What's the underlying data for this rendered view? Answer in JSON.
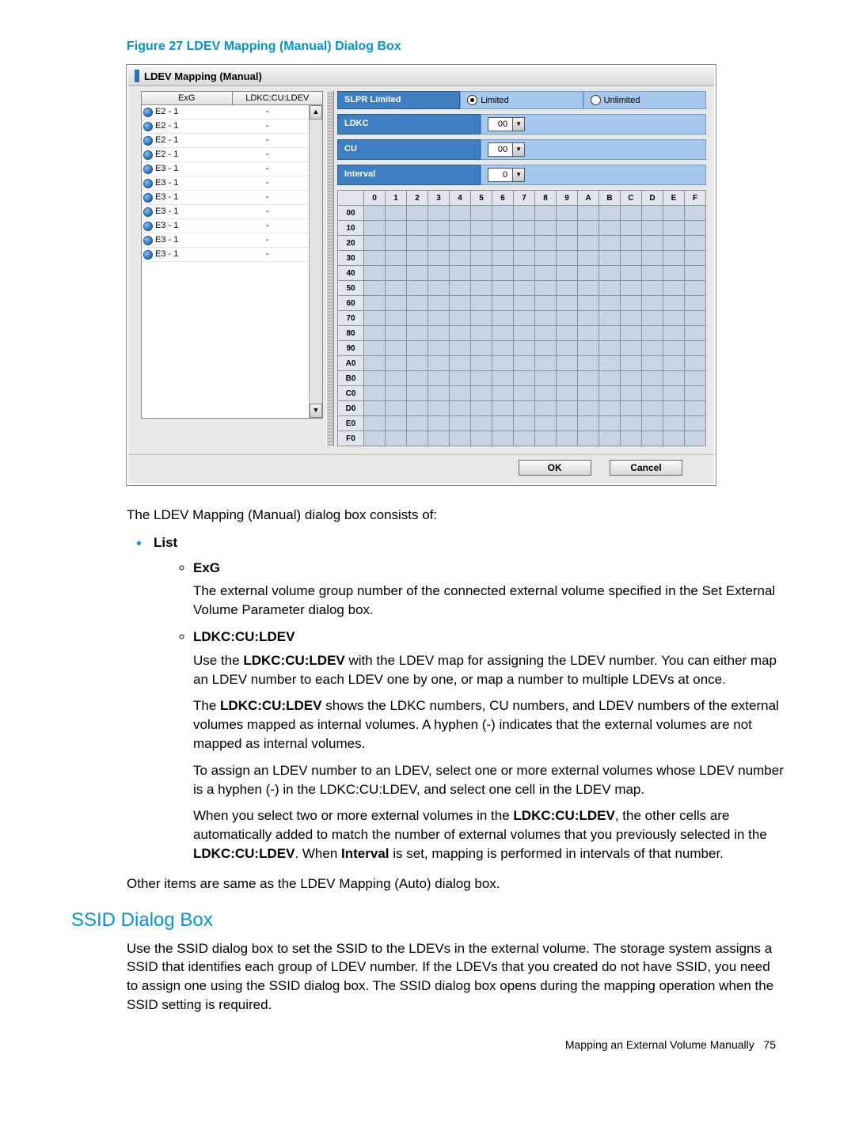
{
  "figure_title": "Figure 27 LDEV Mapping (Manual) Dialog Box",
  "dialog": {
    "title": "LDEV Mapping (Manual)",
    "list_headers": {
      "exg": "ExG",
      "ldev": "LDKC:CU:LDEV"
    },
    "rows": [
      {
        "exg": "E2 - 1",
        "ldev": "-"
      },
      {
        "exg": "E2 - 1",
        "ldev": "-"
      },
      {
        "exg": "E2 - 1",
        "ldev": "-"
      },
      {
        "exg": "E2 - 1",
        "ldev": "-"
      },
      {
        "exg": "E3 - 1",
        "ldev": "-"
      },
      {
        "exg": "E3 - 1",
        "ldev": "-"
      },
      {
        "exg": "E3 - 1",
        "ldev": "-"
      },
      {
        "exg": "E3 - 1",
        "ldev": "-"
      },
      {
        "exg": "E3 - 1",
        "ldev": "-"
      },
      {
        "exg": "E3 - 1",
        "ldev": "-"
      },
      {
        "exg": "E3 - 1",
        "ldev": "-"
      }
    ],
    "slpr_label": "SLPR Limited",
    "radio_limited": "Limited",
    "radio_unlimited": "Unlimited",
    "ldkc_label": "LDKC",
    "ldkc_value": "00",
    "cu_label": "CU",
    "cu_value": "00",
    "interval_label": "Interval",
    "interval_value": "0",
    "col_headers": [
      "0",
      "1",
      "2",
      "3",
      "4",
      "5",
      "6",
      "7",
      "8",
      "9",
      "A",
      "B",
      "C",
      "D",
      "E",
      "F"
    ],
    "row_headers": [
      "00",
      "10",
      "20",
      "30",
      "40",
      "50",
      "60",
      "70",
      "80",
      "90",
      "A0",
      "B0",
      "C0",
      "D0",
      "E0",
      "F0"
    ],
    "ok_label": "OK",
    "cancel_label": "Cancel"
  },
  "para_intro": "The LDEV Mapping (Manual) dialog box consists of:",
  "list_label": "List",
  "exg_label": "ExG",
  "exg_text": "The external volume group number of the connected external volume specified in the Set External Volume Parameter dialog box.",
  "ldkc_label": "LDKC:CU:LDEV",
  "ldkc_p1a": "Use the ",
  "ldkc_p1b": "LDKC:CU:LDEV",
  "ldkc_p1c": " with the LDEV map for assigning the LDEV number. You can either map an LDEV number to each LDEV one by one, or map a number to multiple LDEVs at once.",
  "ldkc_p2a": "The ",
  "ldkc_p2b": "LDKC:CU:LDEV",
  "ldkc_p2c": " shows the LDKC numbers, CU numbers, and LDEV numbers of the external volumes mapped as internal volumes. A hyphen (-) indicates that the external volumes are not mapped as internal volumes.",
  "ldkc_p3": "To assign an LDEV number to an LDEV, select one or more external volumes whose LDEV number is a hyphen (-) in the LDKC:CU:LDEV, and select one cell in the LDEV map.",
  "ldkc_p4a": "When you select two or more external volumes in the ",
  "ldkc_p4b": "LDKC:CU:LDEV",
  "ldkc_p4c": ", the other cells are automatically added to match the number of external volumes that you previously selected in the ",
  "ldkc_p4d": "LDKC:CU:LDEV",
  "ldkc_p4e": ". When ",
  "ldkc_p4f": "Interval",
  "ldkc_p4g": " is set, mapping is performed in intervals of that number.",
  "para_other": "Other items are same as the LDEV Mapping (Auto) dialog box.",
  "h2_ssid": "SSID Dialog Box",
  "para_ssid": "Use the SSID dialog box to set the SSID to the LDEVs in the external volume. The storage system assigns a SSID that identifies each group of LDEV number. If the LDEVs that you created do not have SSID, you need to assign one using the SSID dialog box. The SSID dialog box opens during the mapping operation when the SSID setting is required.",
  "footer_text": "Mapping an External Volume Manually",
  "footer_page": "75"
}
